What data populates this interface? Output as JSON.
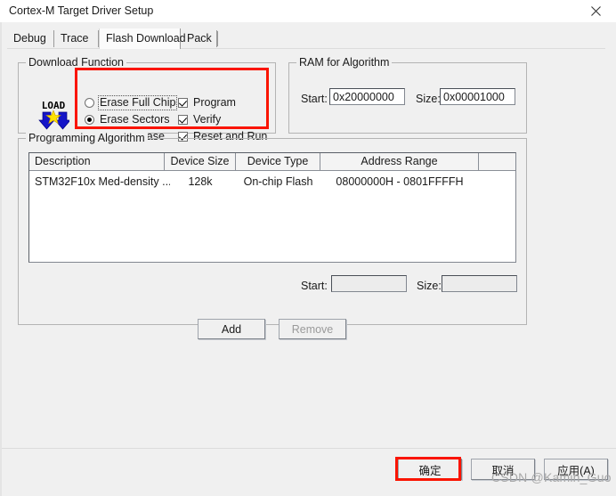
{
  "window": {
    "title": "Cortex-M Target Driver Setup",
    "close_icon": "close-icon"
  },
  "tabs": [
    {
      "label": "Debug",
      "active": false
    },
    {
      "label": "Trace",
      "active": false
    },
    {
      "label": "Flash Download",
      "active": true
    },
    {
      "label": "Pack",
      "active": false
    }
  ],
  "download_function": {
    "title": "Download Function",
    "icon_label": "LOAD",
    "erase_options": [
      {
        "label": "Erase Full Chip",
        "checked": false,
        "focused": true
      },
      {
        "label": "Erase Sectors",
        "checked": true,
        "focused": false
      },
      {
        "label": "Do not Erase",
        "checked": false,
        "focused": false
      }
    ],
    "flags": [
      {
        "label": "Program",
        "checked": true
      },
      {
        "label": "Verify",
        "checked": true
      },
      {
        "label": "Reset and Run",
        "checked": true
      }
    ]
  },
  "ram_for_algorithm": {
    "title": "RAM for Algorithm",
    "start_label": "Start:",
    "start_value": "0x20000000",
    "size_label": "Size:",
    "size_value": "0x00001000"
  },
  "programming_algorithm": {
    "title": "Programming Algorithm",
    "columns": [
      "Description",
      "Device Size",
      "Device Type",
      "Address Range",
      ""
    ],
    "rows": [
      {
        "description": "STM32F10x Med-density ...",
        "device_size": "128k",
        "device_type": "On-chip Flash",
        "address_range": "08000000H - 0801FFFFH"
      }
    ],
    "start_label": "Start:",
    "start_value": "",
    "size_label": "Size:",
    "size_value": ""
  },
  "actions": {
    "add_label": "Add",
    "remove_label": "Remove"
  },
  "footer": {
    "ok_label": "确定",
    "cancel_label": "取消",
    "apply_label": "应用(A)"
  },
  "watermark": {
    "text": "CSDN @Kamin_Guo"
  },
  "colors": {
    "annotation": "#fa1400",
    "dialog_bg": "#f0f0f0",
    "field_bg": "#ffffff"
  }
}
